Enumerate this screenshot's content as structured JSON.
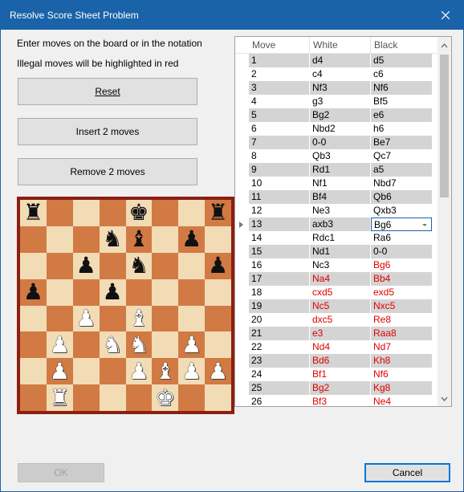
{
  "window": {
    "title": "Resolve Score Sheet Problem"
  },
  "instructions": {
    "line1": "Enter moves on the board or in the notation",
    "line2": "Illegal moves will be highlighted in red"
  },
  "buttons": {
    "reset": "Reset",
    "insert": "Insert 2 moves",
    "remove": "Remove 2 moves",
    "ok": "OK",
    "cancel": "Cancel"
  },
  "grid": {
    "headers": [
      "Move",
      "White",
      "Black"
    ],
    "current_row": 13,
    "rows": [
      {
        "n": "1",
        "w": "d4",
        "b": "d5",
        "wr": false,
        "br": false
      },
      {
        "n": "2",
        "w": "c4",
        "b": "c6",
        "wr": false,
        "br": false
      },
      {
        "n": "3",
        "w": "Nf3",
        "b": "Nf6",
        "wr": false,
        "br": false
      },
      {
        "n": "4",
        "w": "g3",
        "b": "Bf5",
        "wr": false,
        "br": false
      },
      {
        "n": "5",
        "w": "Bg2",
        "b": "e6",
        "wr": false,
        "br": false
      },
      {
        "n": "6",
        "w": "Nbd2",
        "b": "h6",
        "wr": false,
        "br": false
      },
      {
        "n": "7",
        "w": "0-0",
        "b": "Be7",
        "wr": false,
        "br": false
      },
      {
        "n": "8",
        "w": "Qb3",
        "b": "Qc7",
        "wr": false,
        "br": false
      },
      {
        "n": "9",
        "w": "Rd1",
        "b": "a5",
        "wr": false,
        "br": false
      },
      {
        "n": "10",
        "w": "Nf1",
        "b": "Nbd7",
        "wr": false,
        "br": false
      },
      {
        "n": "11",
        "w": "Bf4",
        "b": "Qb6",
        "wr": false,
        "br": false
      },
      {
        "n": "12",
        "w": "Ne3",
        "b": "Qxb3",
        "wr": false,
        "br": false
      },
      {
        "n": "13",
        "w": "axb3",
        "b": "Bg6",
        "wr": false,
        "br": false
      },
      {
        "n": "14",
        "w": "Rdc1",
        "b": "Ra6",
        "wr": false,
        "br": false
      },
      {
        "n": "15",
        "w": "Nd1",
        "b": "0-0",
        "wr": false,
        "br": false
      },
      {
        "n": "16",
        "w": "Nc3",
        "b": "Bg6",
        "wr": false,
        "br": true
      },
      {
        "n": "17",
        "w": "Na4",
        "b": "Bb4",
        "wr": true,
        "br": true
      },
      {
        "n": "18",
        "w": "cxd5",
        "b": "exd5",
        "wr": true,
        "br": true
      },
      {
        "n": "19",
        "w": "Nc5",
        "b": "Nxc5",
        "wr": true,
        "br": true
      },
      {
        "n": "20",
        "w": "dxc5",
        "b": "Re8",
        "wr": true,
        "br": true
      },
      {
        "n": "21",
        "w": "e3",
        "b": "Raa8",
        "wr": true,
        "br": true
      },
      {
        "n": "22",
        "w": "Nd4",
        "b": "Nd7",
        "wr": true,
        "br": true
      },
      {
        "n": "23",
        "w": "Bd6",
        "b": "Kh8",
        "wr": true,
        "br": true
      },
      {
        "n": "24",
        "w": "Bf1",
        "b": "Nf6",
        "wr": true,
        "br": true
      },
      {
        "n": "25",
        "w": "Bg2",
        "b": "Kg8",
        "wr": true,
        "br": true
      },
      {
        "n": "26",
        "w": "Bf3",
        "b": "Ne4",
        "wr": true,
        "br": true
      }
    ]
  },
  "board": {
    "ranks": [
      [
        "bR",
        "",
        "",
        "",
        "bK",
        "",
        "",
        "bR"
      ],
      [
        "",
        "",
        "",
        "bN",
        "bB",
        "",
        "bP",
        ""
      ],
      [
        "",
        "",
        "bP",
        "",
        "bN",
        "",
        "",
        "bP"
      ],
      [
        "bP",
        "",
        "",
        "bP",
        "",
        "",
        "",
        ""
      ],
      [
        "",
        "",
        "wP",
        "",
        "wB",
        "",
        "",
        ""
      ],
      [
        "",
        "wP",
        "",
        "wN",
        "wN",
        "",
        "wP",
        ""
      ],
      [
        "",
        "wP",
        "",
        "",
        "wP",
        "wB",
        "wP",
        "wP"
      ],
      [
        "",
        "wR",
        "",
        "",
        "",
        "wK",
        "",
        ""
      ]
    ]
  },
  "colors": {
    "titlebar": "#1a63a8",
    "illegal": "#e00000",
    "board_light": "#f2dcb6",
    "board_dark": "#d27a44"
  }
}
